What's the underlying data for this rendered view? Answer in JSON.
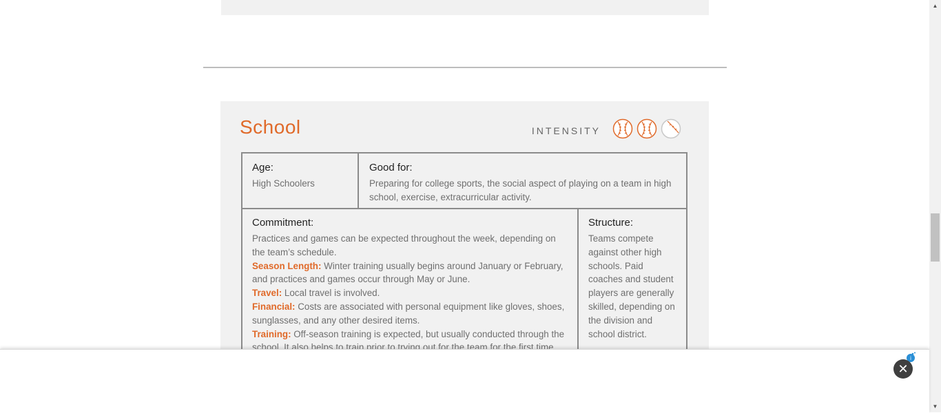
{
  "card": {
    "title": "School",
    "intensity_label": "INTENSITY",
    "intensity_level": 2,
    "intensity_max": 3
  },
  "age": {
    "heading": "Age:",
    "value": "High Schoolers"
  },
  "good_for": {
    "heading": "Good for:",
    "value": "Preparing for college sports, the social aspect of playing on a team in high school, exercise, extracurricular activity."
  },
  "commitment": {
    "heading": "Commitment:",
    "intro": "Practices and games can be expected throughout the week, depending on the team’s schedule.",
    "details": [
      {
        "key": "Season Length:",
        "text": " Winter training usually begins around January or February, and practices and games occur through May or June."
      },
      {
        "key": "Travel:",
        "text": " Local travel is involved."
      },
      {
        "key": "Financial:",
        "text": " Costs are associated with personal equipment like gloves, shoes, sunglasses, and any other desired items."
      },
      {
        "key": "Training:",
        "text": " Off-season training is expected, but usually conducted through the school. It also helps to train prior to trying out for the team for the first time."
      }
    ]
  },
  "structure": {
    "heading": "Structure:",
    "value": "Teams compete against other high schools. Paid coaches and student players are generally skilled, depending on the division and school district."
  },
  "ad": {
    "close_symbol": "✕"
  },
  "scrollbar": {
    "up_symbol": "▲",
    "down_symbol": "▼"
  },
  "colors": {
    "accent": "#e06a2a",
    "card_bg": "#f1f1f1",
    "border": "#8b8b8b",
    "ball_inactive": "#c8c8c8"
  },
  "icons": {
    "active_ball": "baseball-icon",
    "inactive_ball": "baseball-outline-icon",
    "close": "close-icon",
    "ad_badge": "ad-choices-icon"
  }
}
